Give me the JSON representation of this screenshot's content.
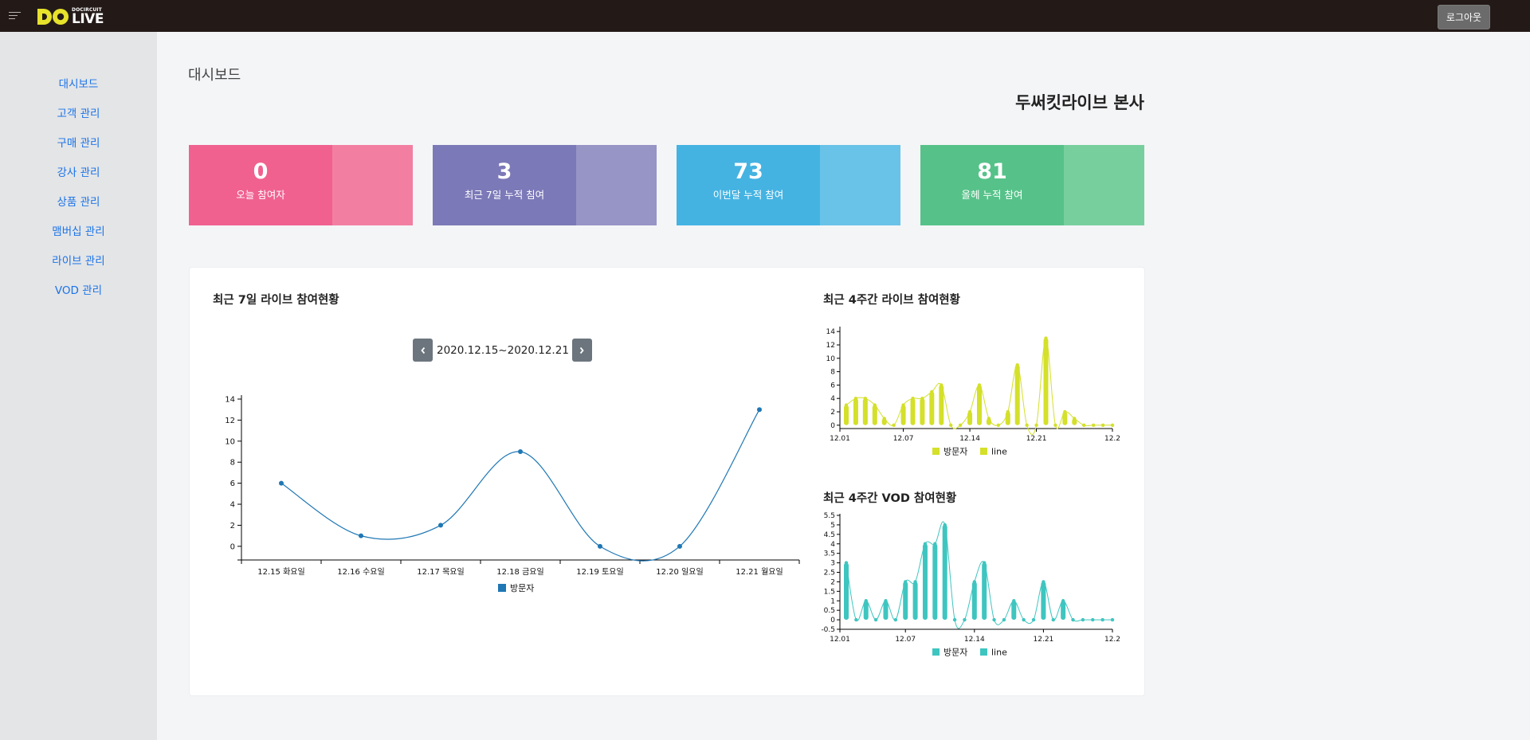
{
  "header": {
    "logo_small": "DOCIRCUIT",
    "logo_big": "LIVE",
    "logout_label": "로그아웃"
  },
  "sidebar": {
    "items": [
      {
        "label": "대시보드"
      },
      {
        "label": "고객 관리"
      },
      {
        "label": "구매 관리"
      },
      {
        "label": "강사 관리"
      },
      {
        "label": "상품 관리"
      },
      {
        "label": "맴버십 관리"
      },
      {
        "label": "라이브 관리"
      },
      {
        "label": "VOD 관리"
      }
    ]
  },
  "main": {
    "page_title": "대시보드",
    "org_name": "두써킷라이브 본사"
  },
  "stats": [
    {
      "value": "0",
      "label": "오늘 참여자",
      "color": "#f06190",
      "side_color": "#f27fa2"
    },
    {
      "value": "3",
      "label": "최근 7일 누적 침여",
      "color": "#7c79b8",
      "side_color": "#9794c6"
    },
    {
      "value": "73",
      "label": "이번달 누적 참여",
      "color": "#44b3e2",
      "side_color": "#69c3e8"
    },
    {
      "value": "81",
      "label": "올헤 누적 참여",
      "color": "#56c289",
      "side_color": "#78cf9e"
    }
  ],
  "weekly": {
    "title": "최근 7일 라이브 참여현황",
    "date_range": "2020.12.15~2020.12.21"
  },
  "live4w": {
    "title": "최근 4주간 라이브 참여현황"
  },
  "vod4w": {
    "title": "최근 4주간 VOD 참여현황"
  },
  "chart_data": [
    {
      "type": "line",
      "title": "최근 7일 라이브 참여현황",
      "categories": [
        "12.15 화요일",
        "12.16 수요일",
        "12.17 목요일",
        "12.18 금요일",
        "12.19 토요일",
        "12.20 일요일",
        "12.21 월요일"
      ],
      "series": [
        {
          "name": "방문자",
          "values": [
            6,
            1,
            2,
            9,
            0,
            0,
            13
          ]
        }
      ],
      "ylim": [
        -1.3,
        14
      ],
      "yticks": [
        0,
        2,
        4,
        6,
        8,
        10,
        12,
        14
      ],
      "color": "#1f77b4",
      "legend": "bottom-center"
    },
    {
      "type": "bar",
      "title": "최근 4주간 라이브 참여현황",
      "x_start": "12.01",
      "xtick_labels": [
        "12.01",
        "12.07",
        "12.14",
        "12.21",
        "12.2"
      ],
      "series": [
        {
          "name": "방문자",
          "values": [
            3,
            4,
            4,
            3,
            1,
            0,
            3,
            4,
            4,
            5,
            6,
            0,
            0,
            2,
            6,
            1,
            0,
            2,
            9,
            0,
            0,
            13,
            0,
            2,
            1,
            0,
            0,
            0,
            0
          ]
        },
        {
          "name": "line",
          "values": [
            3,
            4,
            4,
            3,
            1,
            0,
            3,
            4,
            4,
            5,
            6,
            0,
            0,
            2,
            6,
            1,
            0,
            2,
            9,
            0,
            0,
            13,
            0,
            2,
            1,
            0,
            0,
            0,
            0
          ]
        }
      ],
      "ylim": [
        -0.5,
        14.5
      ],
      "yticks": [
        0,
        2,
        4,
        6,
        8,
        10,
        12,
        14
      ],
      "color": "#d4e02a",
      "legend": "bottom-center"
    },
    {
      "type": "bar",
      "title": "최근 4주간 VOD 참여현황",
      "x_start": "12.01",
      "xtick_labels": [
        "12.01",
        "12.07",
        "12.14",
        "12.21",
        "12.2"
      ],
      "series": [
        {
          "name": "방문자",
          "values": [
            3,
            0,
            1,
            0,
            1,
            0,
            2,
            2,
            4,
            4,
            5,
            0,
            0,
            2,
            3,
            0,
            0,
            1,
            0,
            0,
            2,
            0,
            1,
            0,
            0,
            0,
            0,
            0
          ]
        },
        {
          "name": "line",
          "values": [
            3,
            0,
            1,
            0,
            1,
            0,
            2,
            2,
            4,
            4,
            5,
            0,
            0,
            2,
            3,
            0,
            0,
            1,
            0,
            0,
            2,
            0,
            1,
            0,
            0,
            0,
            0,
            0
          ]
        }
      ],
      "ylim": [
        -0.5,
        5.5
      ],
      "yticks": [
        -0.5,
        0,
        0.5,
        1,
        1.5,
        2,
        2.5,
        3,
        3.5,
        4,
        4.5,
        5,
        5.5
      ],
      "color": "#3fc5c0",
      "legend": "bottom-center"
    }
  ]
}
